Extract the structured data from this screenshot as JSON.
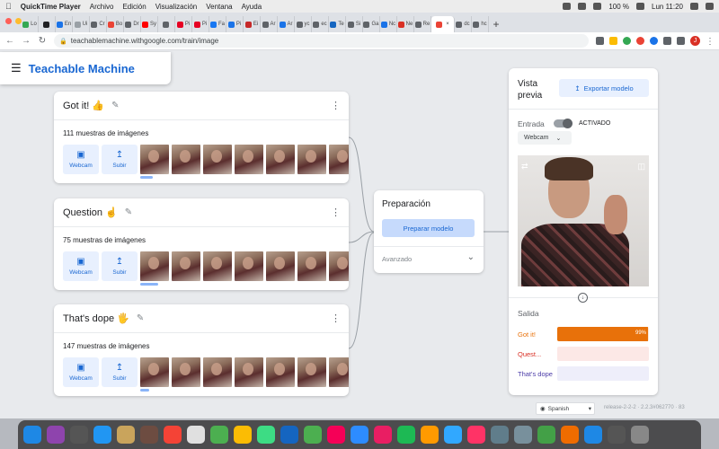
{
  "menubar": {
    "app_name": "QuickTime Player",
    "items": [
      "Archivo",
      "Edición",
      "Visualización",
      "Ventana",
      "Ayuda"
    ],
    "battery": "100 %",
    "clock": "Lun 11:20"
  },
  "tabs": [
    {
      "label": "Lo",
      "color": "#34a853"
    },
    {
      "label": "",
      "color": "#202124"
    },
    {
      "label": "En",
      "color": "#1a73e8"
    },
    {
      "label": "Ui",
      "color": "#9aa0a6"
    },
    {
      "label": "Cr",
      "color": "#5f6368"
    },
    {
      "label": "Bo",
      "color": "#ea4335"
    },
    {
      "label": "Dr",
      "color": "#5f6368"
    },
    {
      "label": "Sy",
      "color": "#ff0000"
    },
    {
      "label": "",
      "color": "#5f6368"
    },
    {
      "label": "Pi",
      "color": "#e60023"
    },
    {
      "label": "Pi",
      "color": "#e60023"
    },
    {
      "label": "Fa",
      "color": "#1877f2"
    },
    {
      "label": "Pi",
      "color": "#1a73e8"
    },
    {
      "label": "Ei",
      "color": "#c62828"
    },
    {
      "label": "Ar",
      "color": "#5f6368"
    },
    {
      "label": "Ar",
      "color": "#1a73e8"
    },
    {
      "label": "yc",
      "color": "#5f6368"
    },
    {
      "label": "ec",
      "color": "#5f6368"
    },
    {
      "label": "Te",
      "color": "#1565c0"
    },
    {
      "label": "Si",
      "color": "#5f6368"
    },
    {
      "label": "Ga",
      "color": "#5f6368"
    },
    {
      "label": "Nc",
      "color": "#1a73e8"
    },
    {
      "label": "Ne",
      "color": "#d93025"
    },
    {
      "label": "Re",
      "color": "#5f6368"
    },
    {
      "label": "",
      "color": "#ea4335",
      "active": true
    },
    {
      "label": "dc",
      "color": "#5f6368"
    },
    {
      "label": "hc",
      "color": "#5f6368"
    }
  ],
  "address": {
    "url": "teachablemachine.withgoogle.com/train/image"
  },
  "app": {
    "title": "Teachable Machine"
  },
  "classes": [
    {
      "name": "Got it! 👍",
      "samples": "111 muestras de imágenes",
      "webcam": "Webcam",
      "upload": "Subir"
    },
    {
      "name": "Question ☝",
      "samples": "75 muestras de imágenes",
      "webcam": "Webcam",
      "upload": "Subir"
    },
    {
      "name": "That's dope 🖐",
      "samples": "147 muestras de imágenes",
      "webcam": "Webcam",
      "upload": "Subir"
    }
  ],
  "training": {
    "title": "Preparación",
    "button": "Preparar modelo",
    "advanced": "Avanzado"
  },
  "preview": {
    "title": "Vista previa",
    "export": "Exportar modelo",
    "input_label": "Entrada",
    "toggle_state": "ACTIVADO",
    "source": "Webcam",
    "output_label": "Salida",
    "outputs": [
      {
        "label": "Got it!",
        "fraction": 0.99,
        "percent_text": "99%",
        "color": "#e8710a",
        "track": "#fce8db",
        "text_color": "#e8710a"
      },
      {
        "label": "Quest...",
        "fraction": 0.0,
        "percent_text": "",
        "color": "#d93025",
        "track": "#fce8e6",
        "text_color": "#d93025"
      },
      {
        "label": "That's dope",
        "fraction": 0.0,
        "percent_text": "",
        "color": "#5f4bb6",
        "track": "#eeeefa",
        "text_color": "#4b3ca8"
      }
    ]
  },
  "footer": {
    "language": "Spanish",
    "release": "release-2-2-2 · 2.2.3#062770 · 83"
  }
}
